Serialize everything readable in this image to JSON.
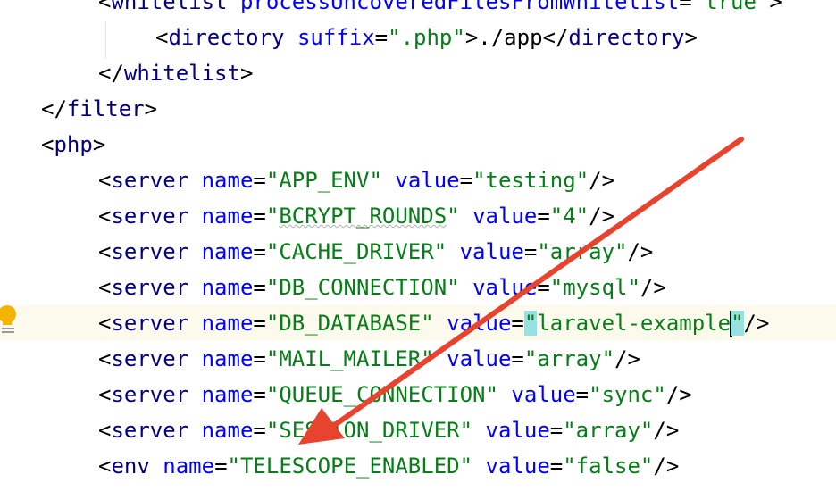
{
  "editor": {
    "lines": [
      {
        "indent": 1,
        "type": "open",
        "tag": "whitelist",
        "attrs": [
          {
            "name": "processUncoveredFilesFromWhitelist",
            "value": "true"
          }
        ],
        "close": ">"
      },
      {
        "indent": 2,
        "type": "element",
        "tag": "directory",
        "attrs": [
          {
            "name": "suffix",
            "value": ".php"
          }
        ],
        "text": "./app"
      },
      {
        "indent": 1,
        "type": "end",
        "tag": "whitelist"
      },
      {
        "indent": 0,
        "type": "end",
        "tag": "filter"
      },
      {
        "indent": 0,
        "type": "open",
        "tag": "php",
        "attrs": [],
        "close": ">"
      },
      {
        "indent": 1,
        "type": "self",
        "tag": "server",
        "attrs": [
          {
            "name": "name",
            "value": "APP_ENV"
          },
          {
            "name": "value",
            "value": "testing"
          }
        ]
      },
      {
        "indent": 1,
        "type": "self",
        "tag": "server",
        "attrs": [
          {
            "name": "name",
            "value": "BCRYPT_ROUNDS"
          },
          {
            "name": "value",
            "value": "4"
          }
        ]
      },
      {
        "indent": 1,
        "type": "self",
        "tag": "server",
        "attrs": [
          {
            "name": "name",
            "value": "CACHE_DRIVER"
          },
          {
            "name": "value",
            "value": "array"
          }
        ]
      },
      {
        "indent": 1,
        "type": "self",
        "tag": "server",
        "attrs": [
          {
            "name": "name",
            "value": "DB_CONNECTION"
          },
          {
            "name": "value",
            "value": "mysql"
          }
        ]
      },
      {
        "indent": 1,
        "type": "self",
        "tag": "server",
        "current": true,
        "attrs": [
          {
            "name": "name",
            "value": "DB_DATABASE"
          },
          {
            "name": "value",
            "value": "laravel-example"
          }
        ]
      },
      {
        "indent": 1,
        "type": "self",
        "tag": "server",
        "attrs": [
          {
            "name": "name",
            "value": "MAIL_MAILER"
          },
          {
            "name": "value",
            "value": "array"
          }
        ]
      },
      {
        "indent": 1,
        "type": "self",
        "tag": "server",
        "attrs": [
          {
            "name": "name",
            "value": "QUEUE_CONNECTION"
          },
          {
            "name": "value",
            "value": "sync"
          }
        ]
      },
      {
        "indent": 1,
        "type": "self",
        "tag": "server",
        "attrs": [
          {
            "name": "name",
            "value": "SESSION_DRIVER"
          },
          {
            "name": "value",
            "value": "array"
          }
        ]
      },
      {
        "indent": 1,
        "type": "self",
        "tag": "env",
        "attrs": [
          {
            "name": "name",
            "value": "TELESCOPE_ENABLED"
          },
          {
            "name": "value",
            "value": "false"
          }
        ]
      }
    ]
  },
  "icons": {
    "intention": "lightbulb-icon",
    "annotation": "red-arrow-icon"
  },
  "colors": {
    "tag": "#000080",
    "attribute": "#0000ff",
    "value": "#067d17",
    "current_line": "#fcfaed",
    "quote_highlight": "#99e0e0",
    "arrow": "#e8432f",
    "bulb": "#f5b400"
  }
}
